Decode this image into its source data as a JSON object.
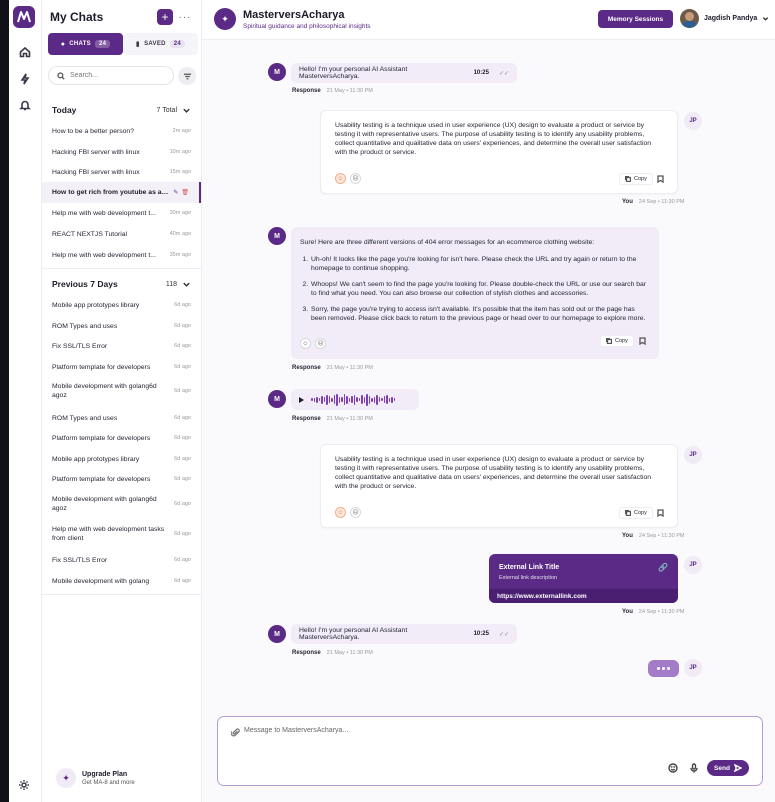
{
  "sidebar": {
    "title": "My Chats",
    "plus": "+",
    "more": "···",
    "tabs": [
      {
        "label": "CHATS",
        "count": "24"
      },
      {
        "label": "SAVED",
        "count": "24"
      }
    ],
    "search_placeholder": "Search...",
    "today": {
      "label": "Today",
      "count": "7 Total"
    },
    "today_items": [
      {
        "text": "How to be a better person?",
        "time": "2m ago"
      },
      {
        "text": "Hacking FBI server with linux",
        "time": "10m ago"
      },
      {
        "text": "Hacking FBI server with linux",
        "time": "15m ago"
      },
      {
        "text": "How to get rich from youtube as an i...",
        "time": ""
      },
      {
        "text": "Help me with web development t...",
        "time": "30m ago"
      },
      {
        "text": "REACT NEXTJS Tutorial",
        "time": "40m ago"
      },
      {
        "text": "Help me with web development t...",
        "time": "35m ago"
      }
    ],
    "previous": {
      "label": "Previous 7 Days",
      "count": "118"
    },
    "previous_items": [
      {
        "text": "Mobile app prototypes library",
        "time": "6d ago"
      },
      {
        "text": "ROM Types and uses",
        "time": "6d ago"
      },
      {
        "text": "Fix SSL/TLS Error",
        "time": "6d ago"
      },
      {
        "text": "Platform template for developers",
        "time": "6d ago"
      },
      {
        "text": "Mobile development with golang6d agoz",
        "time": "6d ago"
      },
      {
        "text": "ROM Types and uses",
        "time": "6d ago"
      },
      {
        "text": "Platform template for developers",
        "time": "6d ago"
      },
      {
        "text": "Mobile app prototypes library",
        "time": "6d ago"
      },
      {
        "text": "Platform template for developers",
        "time": "6d ago"
      },
      {
        "text": "Mobile development with golang6d agoz",
        "time": "6d ago"
      },
      {
        "text": "Help me with web development tasks from client",
        "time": "6d ago"
      },
      {
        "text": "Fix SSL/TLS Error",
        "time": "6d ago"
      },
      {
        "text": "Mobile development with golang",
        "time": "6d ago"
      }
    ],
    "upgrade": {
      "title": "Upgrade Plan",
      "sub": "Get MA-8 and more"
    }
  },
  "header": {
    "title": "MasterversAcharya",
    "subtitle": "Spiritual guidance and philosophical insights",
    "memory_button": "Memory Sessions",
    "user_name": "Jagdish Pandya"
  },
  "messages": {
    "greeting": "Hello! I'm your personal AI Assistant MasterversAcharya.",
    "greeting_time": "10:25",
    "response_label": "Response",
    "bot_meta_time": "21 May • 11:30 PM",
    "you_label": "You",
    "user_meta_time": "24 Sep • 11:30 PM",
    "user_initials": "JP",
    "usability_text": "Usability testing is a technique used in user experience (UX) design to evaluate a product or service by testing it with representative users. The purpose of usability testing is to identify any usability problems, collect quantitative and qualitative data on users' experiences, and determine the overall user satisfaction with the product or service.",
    "copy_label": "Copy",
    "error_intro": "Sure! Here are three different versions of 404 error messages for an ecommerce clothing website:",
    "error_list": [
      "Uh-oh! It looks like the page you're looking for isn't here. Please check the URL and try again or return to the homepage to continue shopping.",
      "Whoops! We can't seem to find the page you're looking for. Please double-check the URL or use our search bar to find what you need. You can also browse our collection of stylish clothes and accessories.",
      "Sorry, the page you're trying to access isn't available. It's possible that the item has sold out or the page has been removed. Please click back to return to the previous page or head over to our homepage to explore more."
    ],
    "link": {
      "title": "External Link Title",
      "desc": "External link description",
      "url": "https://www.externallink.com"
    }
  },
  "composer": {
    "placeholder": "Message to MasterversAcharya...",
    "send": "Send"
  },
  "colors": {
    "accent": "#5b2a86",
    "bubble": "#f1ecf7"
  }
}
